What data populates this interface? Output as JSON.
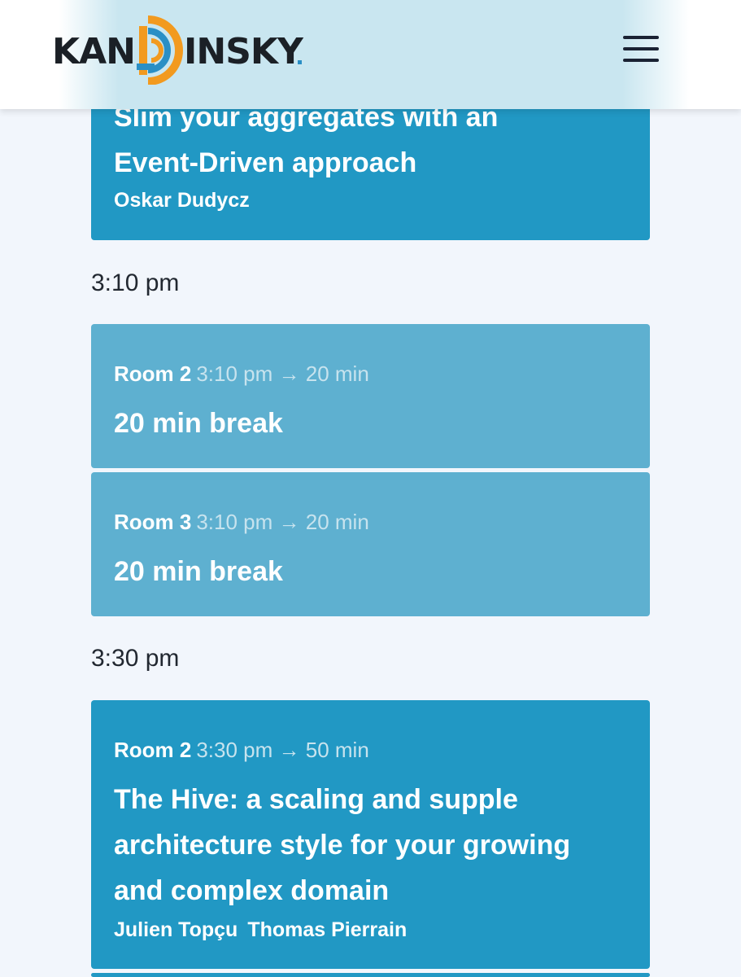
{
  "brand": {
    "logo_text_left": "KAN",
    "logo_text_right": "INSKY",
    "logo_alt": "KANDINSKY"
  },
  "schedule": {
    "session_prev": {
      "title_line_1": "Slim your aggregates with an",
      "title_line_2": "Event-Driven approach",
      "speakers": [
        "Oskar Dudycz"
      ]
    },
    "slot_1": {
      "time": "3:10 pm",
      "items": [
        {
          "room": "Room 2",
          "time": "3:10 pm → 20 min",
          "title": "20 min break"
        },
        {
          "room": "Room 3",
          "time": "3:10 pm → 20 min",
          "title": "20 min break"
        }
      ]
    },
    "slot_2": {
      "time": "3:30 pm",
      "items": [
        {
          "room": "Room 2",
          "time": "3:30 pm → 50 min",
          "title_line_1": "The Hive: a scaling and supple",
          "title_line_2": "architecture style for your growing",
          "title_line_3": "and complex domain",
          "speakers": [
            "Julien Topçu",
            "Thomas Pierrain"
          ]
        }
      ]
    }
  },
  "colors": {
    "session_bg": "#2198c4",
    "break_bg": "#5eb0d0",
    "page_bg": "#f2f6fc",
    "logo_orange": "#f29a1f",
    "logo_blue": "#2a8fc5"
  }
}
